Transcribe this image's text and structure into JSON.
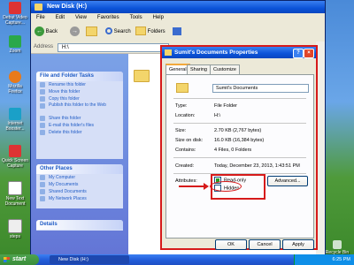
{
  "desktop": {
    "icons": [
      {
        "label": "Debut Video Capture..."
      },
      {
        "label": "Zoom"
      },
      {
        "label": "Mozilla Firefox"
      },
      {
        "label": "Internet Booster..."
      },
      {
        "label": "Quick Screen Capture"
      },
      {
        "label": "New Text Document"
      },
      {
        "label": "steps"
      }
    ],
    "recycle_label": "Recycle Bin"
  },
  "explorer": {
    "title": "New Disk (H:)",
    "menu": [
      "File",
      "Edit",
      "View",
      "Favorites",
      "Tools",
      "Help"
    ],
    "toolbar": {
      "back": "Back",
      "search": "Search",
      "folders": "Folders"
    },
    "address_label": "Address",
    "address_value": "H:\\",
    "file_tasks": {
      "title": "File and Folder Tasks",
      "items": [
        "Rename this folder",
        "Move this folder",
        "Copy this folder",
        "Publish this folder to the Web",
        "Share this folder",
        "E-mail this folder's files",
        "Delete this folder"
      ]
    },
    "other_places": {
      "title": "Other Places",
      "items": [
        "My Computer",
        "My Documents",
        "Shared Documents",
        "My Network Places"
      ]
    },
    "details_title": "Details"
  },
  "dialog": {
    "title": "Sumit's Documents Properties",
    "tabs": [
      "General",
      "Sharing",
      "Customize"
    ],
    "folder_name": "Sumit's Documents",
    "type_label": "Type:",
    "type_value": "File Folder",
    "location_label": "Location:",
    "location_value": "H:\\",
    "size_label": "Size:",
    "size_value": "2.70 KB (2,767 bytes)",
    "disk_label": "Size on disk:",
    "disk_value": "16.0 KB (16,384 bytes)",
    "contains_label": "Contains:",
    "contains_value": "4 Files, 0 Folders",
    "created_label": "Created:",
    "created_value": "Today, December 23, 2013, 1:43:51 PM",
    "attributes_label": "Attributes:",
    "readonly_label": "Read-only",
    "hidden_label": "Hidden",
    "advanced_label": "Advanced...",
    "ok_label": "OK",
    "cancel_label": "Cancel",
    "apply_label": "Apply"
  },
  "taskbar": {
    "start_label": "start",
    "task_label": "New Disk (H:)",
    "clock": "6:25 PM"
  },
  "colors": {
    "accent": "#0b53d8",
    "highlight": "#d61a1a"
  }
}
